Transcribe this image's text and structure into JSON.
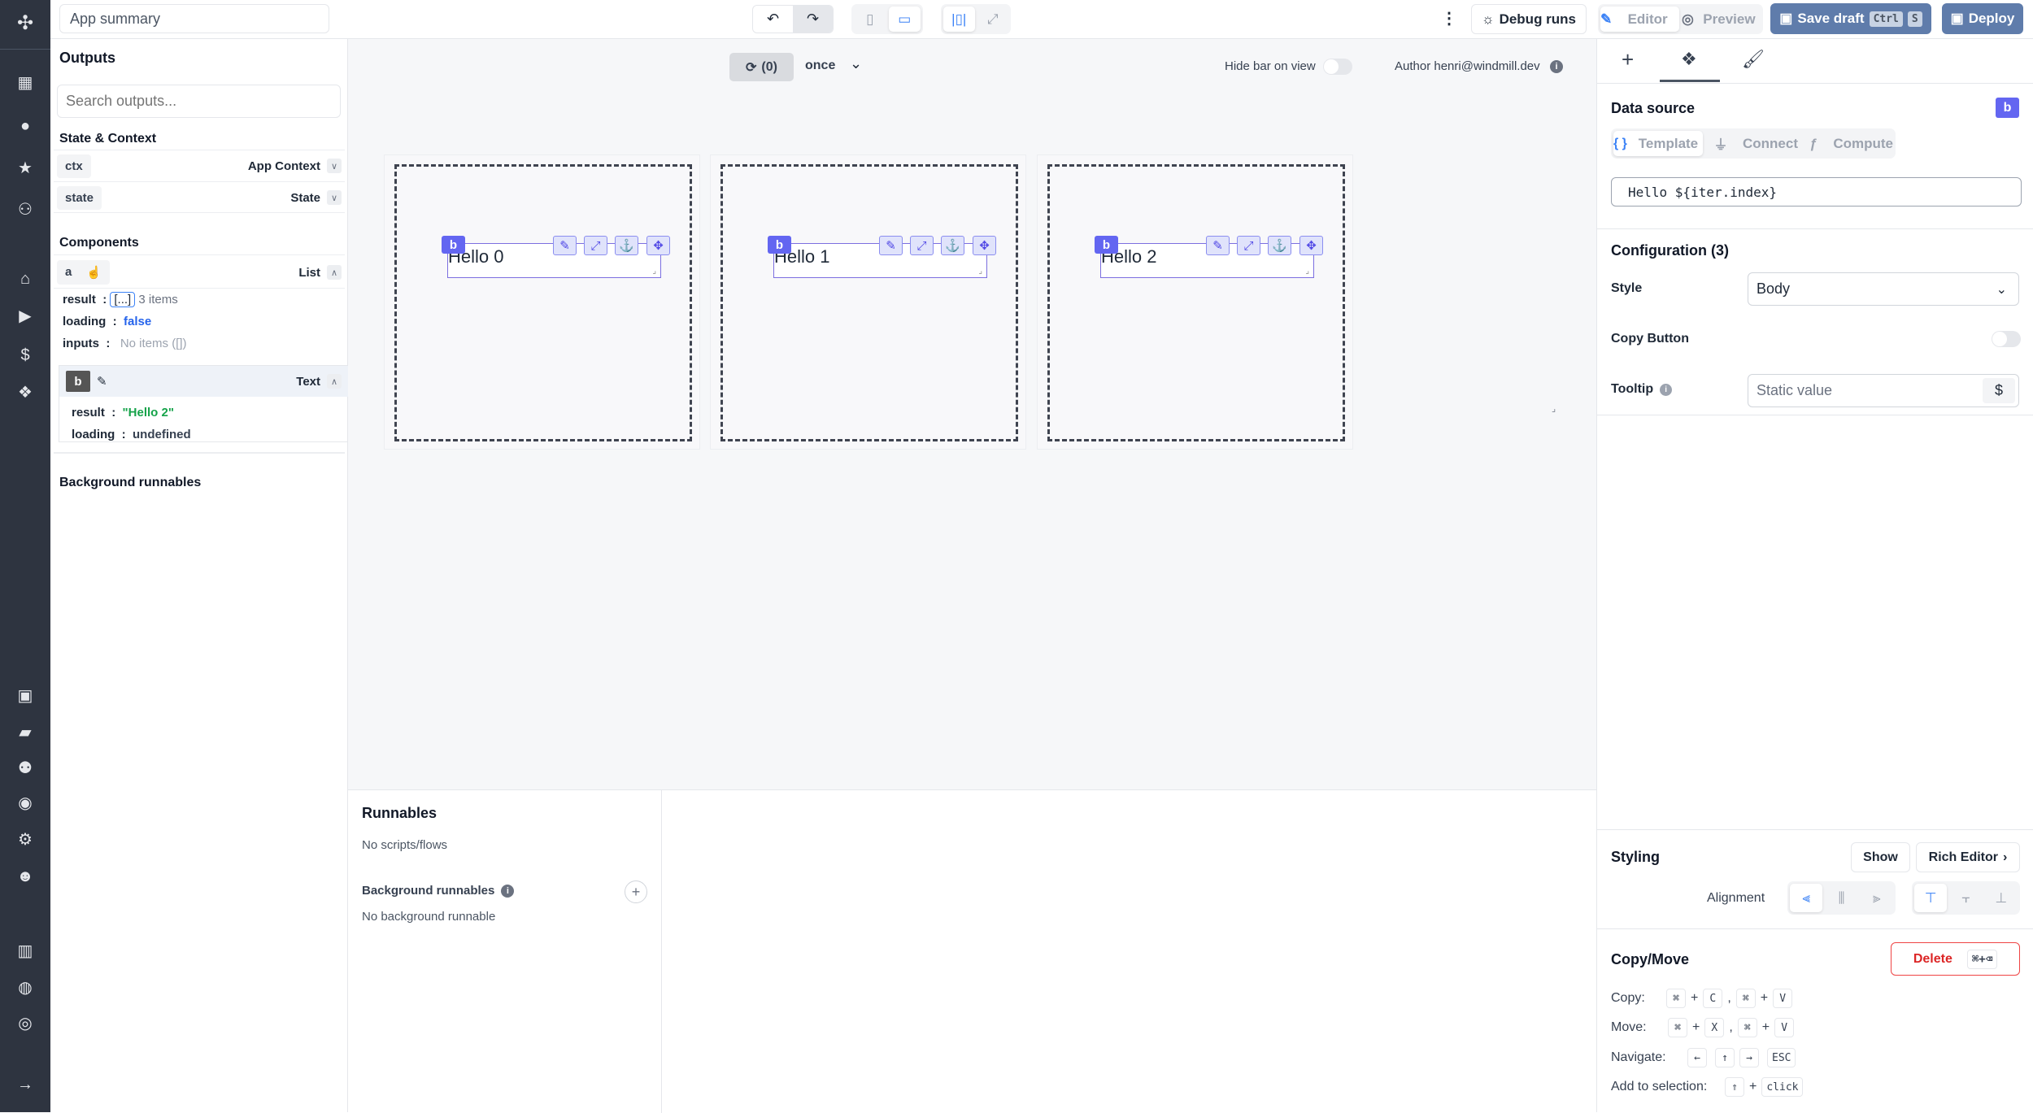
{
  "topbar": {
    "app_title": "App summary",
    "debug_runs": "Debug runs",
    "editor": "Editor",
    "preview": "Preview",
    "save_draft": "Save draft",
    "save_kbd_ctrl": "Ctrl",
    "save_kbd_s": "S",
    "deploy": "Deploy"
  },
  "left": {
    "outputs_title": "Outputs",
    "search_placeholder": "Search outputs...",
    "state_context": "State & Context",
    "ctx": {
      "id": "ctx",
      "label": "App Context"
    },
    "state": {
      "id": "state",
      "label": "State"
    },
    "components": "Components",
    "a": {
      "id": "a",
      "type": "List",
      "result_key": "result",
      "result_val": "[...]",
      "result_count": "3 items",
      "loading_key": "loading",
      "loading_val": "false",
      "inputs_key": "inputs",
      "inputs_val": "No items ([])"
    },
    "b": {
      "id": "b",
      "type": "Text",
      "result_key": "result",
      "result_val": "\"Hello 2\"",
      "loading_key": "loading",
      "loading_val": "undefined"
    },
    "background_runnables": "Background runnables"
  },
  "canvas": {
    "refresh_count": "(0)",
    "refresh_mode": "once",
    "hide_bar": "Hide bar on view",
    "author": "Author henri@windmill.dev",
    "items": [
      {
        "badge": "b",
        "text": "Hello 0"
      },
      {
        "badge": "b",
        "text": "Hello 1"
      },
      {
        "badge": "b",
        "text": "Hello 2"
      }
    ]
  },
  "runnables": {
    "title": "Runnables",
    "empty": "No scripts/flows",
    "bg_title": "Background runnables",
    "bg_empty": "No background runnable"
  },
  "right": {
    "data_source": "Data source",
    "badge": "b",
    "tabs": {
      "template": "Template",
      "connect": "Connect",
      "compute": "Compute"
    },
    "template_value": "Hello ${iter.index}",
    "config_title": "Configuration (3)",
    "style_label": "Style",
    "style_value": "Body",
    "copy_button_label": "Copy Button",
    "copy_button_on": false,
    "tooltip_label": "Tooltip",
    "tooltip_placeholder": "Static value",
    "styling": "Styling",
    "show": "Show",
    "rich_editor": "Rich Editor",
    "alignment": "Alignment",
    "copy_move": "Copy/Move",
    "delete": "Delete",
    "delete_kbd": "⌘+⌫",
    "shortcuts": {
      "copy": "Copy:",
      "move": "Move:",
      "navigate": "Navigate:",
      "add": "Add to selection:",
      "cmd": "⌘",
      "plus": "+",
      "c": "C",
      "v": "V",
      "x": "X",
      "left": "←",
      "up": "↑",
      "right": "→",
      "esc": "ESC",
      "shift": "⇑",
      "click": "click"
    }
  },
  "colors": {
    "nav_bg": "#2e3440",
    "accent": "#6366f1",
    "primary_btn": "#5f7cab",
    "danger": "#dc2626"
  }
}
